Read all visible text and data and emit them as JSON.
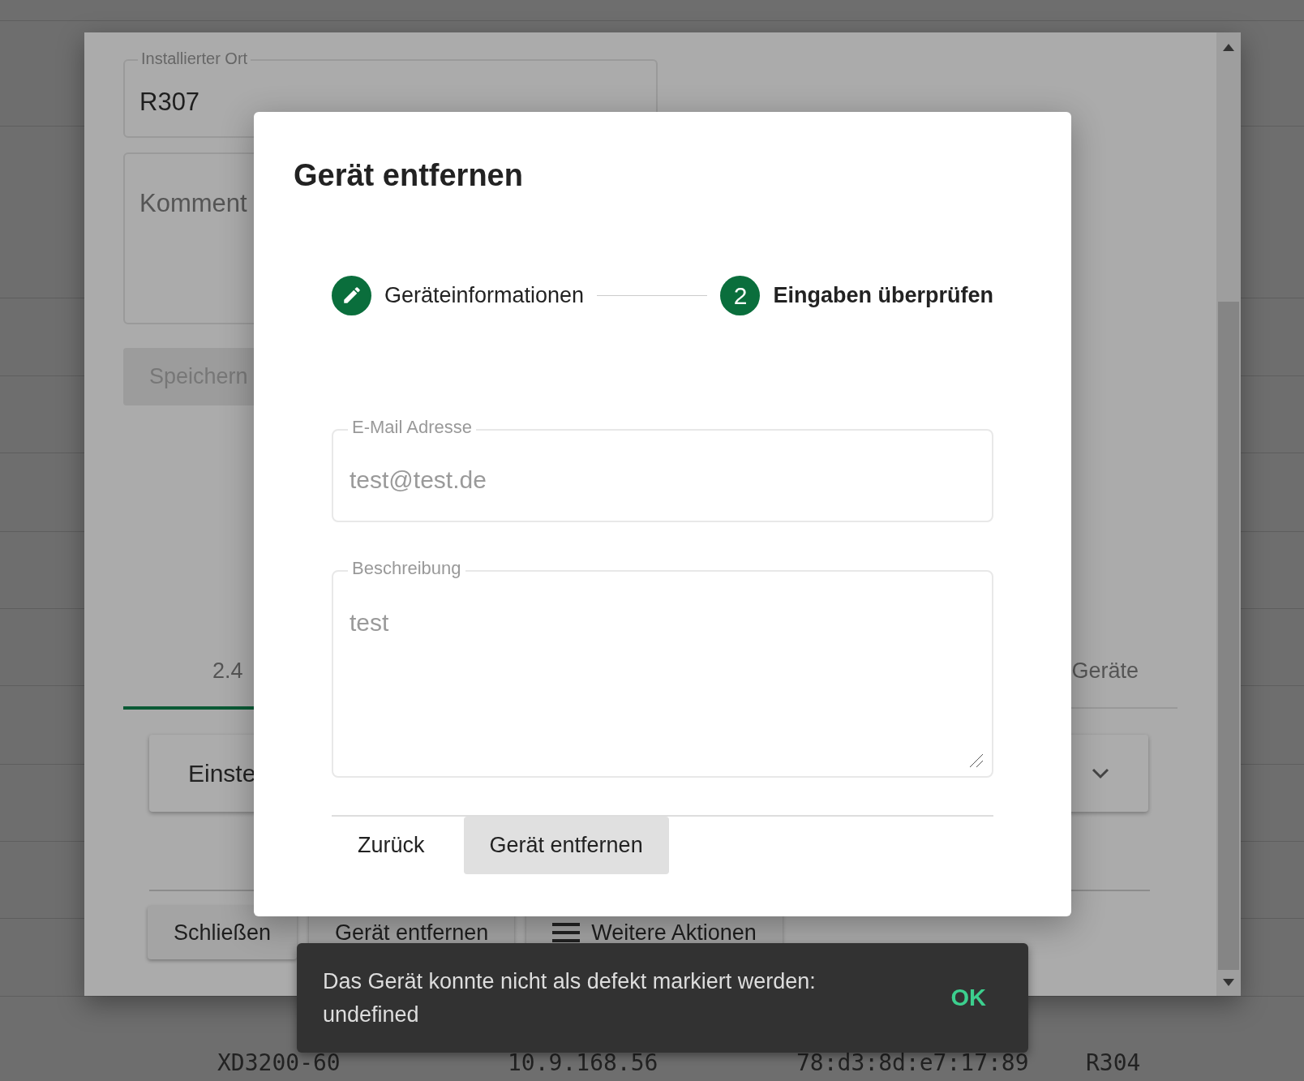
{
  "background_table": {
    "rows": [
      {
        "cells": [
          "XD3200-60",
          "10.9.168.56",
          "78:d3:8d:e7:17:89",
          "R304"
        ]
      }
    ]
  },
  "device_dialog": {
    "location_field": {
      "label": "Installierter Ort",
      "value": "R307"
    },
    "comment_field": {
      "placeholder": "Komment"
    },
    "save_button": {
      "label": "Speichern",
      "disabled": true
    },
    "tabs": [
      {
        "label": "2.4",
        "selected": true
      },
      {
        "label": "Geräte",
        "selected": false
      }
    ],
    "panel": {
      "title": "Einste",
      "expanded": false
    },
    "buttons": [
      {
        "label": "Schließen",
        "kind": "plain"
      },
      {
        "label": "Gerät entfernen",
        "kind": "plain"
      },
      {
        "label": "Weitere Aktionen",
        "kind": "menu"
      }
    ]
  },
  "modal": {
    "title": "Gerät entfernen",
    "steps": [
      {
        "kind": "edit",
        "label": "Geräteinformationen",
        "selected": false
      },
      {
        "kind": "number",
        "number": "2",
        "label": "Eingaben überprüfen",
        "selected": true
      }
    ],
    "fields": [
      {
        "kind": "input",
        "label": "E-Mail Adresse",
        "value": "test@test.de",
        "disabled": true
      },
      {
        "kind": "textarea",
        "label": "Beschreibung",
        "value": "test",
        "disabled": true
      }
    ],
    "actions": [
      {
        "kind": "text",
        "label": "Zurück"
      },
      {
        "kind": "filled",
        "label": "Gerät entfernen"
      }
    ]
  },
  "snackbar": {
    "message": "Das Gerät konnte nicht als defekt markiert werden: undefined",
    "action": "OK"
  }
}
